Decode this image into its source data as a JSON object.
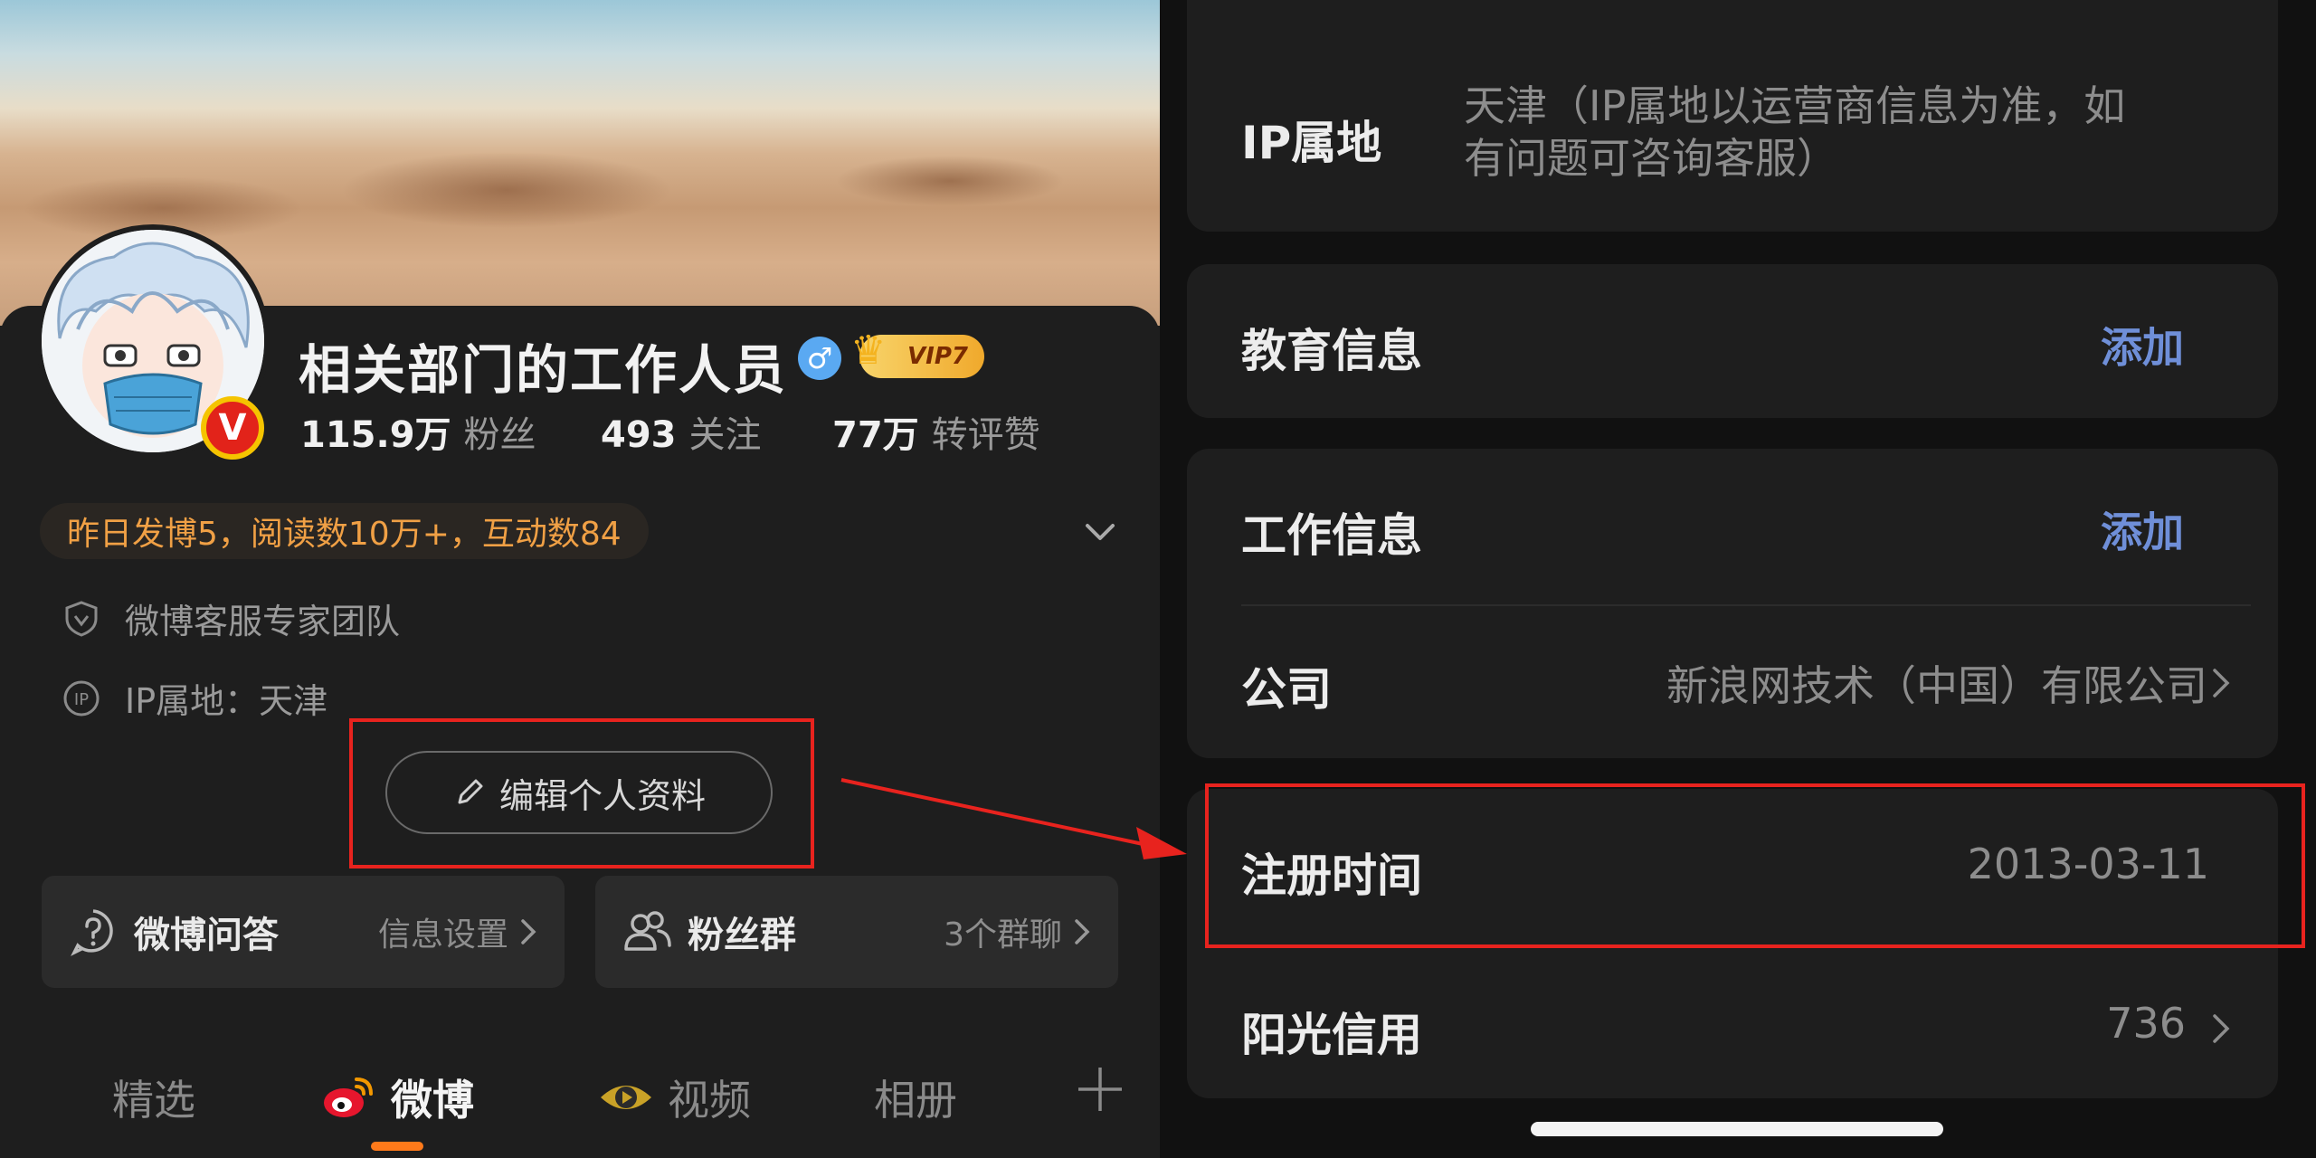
{
  "profile": {
    "nickname": "相关部门的工作人员",
    "vip_label": "VIP7",
    "verified_badge": "V",
    "gender_symbol": "♂",
    "stats": [
      {
        "value": "115.9万",
        "label": "粉丝"
      },
      {
        "value": "493",
        "label": "关注"
      },
      {
        "value": "77万",
        "label": "转评赞"
      }
    ],
    "yesterday_summary": "昨日发博5，阅读数10万+，互动数84",
    "team": "微博客服专家团队",
    "ip_location": "IP属地：天津",
    "edit_button": "编辑个人资料"
  },
  "quick_cards": [
    {
      "title": "微博问答",
      "sub": "信息设置"
    },
    {
      "title": "粉丝群",
      "sub": "3个群聊"
    }
  ],
  "tabs": [
    "精选",
    "微博",
    "视频",
    "相册"
  ],
  "details": {
    "ip": {
      "label": "IP属地",
      "value_line1": "天津（IP属地以运营商信息为准，如",
      "value_line2": "有问题可咨询客服）"
    },
    "education": {
      "label": "教育信息",
      "action": "添加"
    },
    "work": {
      "label": "工作信息",
      "action": "添加"
    },
    "company": {
      "label": "公司",
      "value": "新浪网技术（中国）有限公司"
    },
    "register": {
      "label": "注册时间",
      "value": "2013-03-11"
    },
    "credit": {
      "label": "阳光信用",
      "value": "736"
    }
  },
  "colors": {
    "accent_orange": "#ff7a1a",
    "link_blue": "#6f8fd8",
    "highlight_red": "#e8231e",
    "summary_orange": "#f0a045"
  },
  "icons": [
    "shield-icon",
    "ip-icon",
    "pencil-icon",
    "question-icon",
    "group-icon",
    "weibo-logo-icon",
    "video-icon",
    "plus-icon",
    "chevron-down-icon",
    "chevron-right-icon"
  ]
}
